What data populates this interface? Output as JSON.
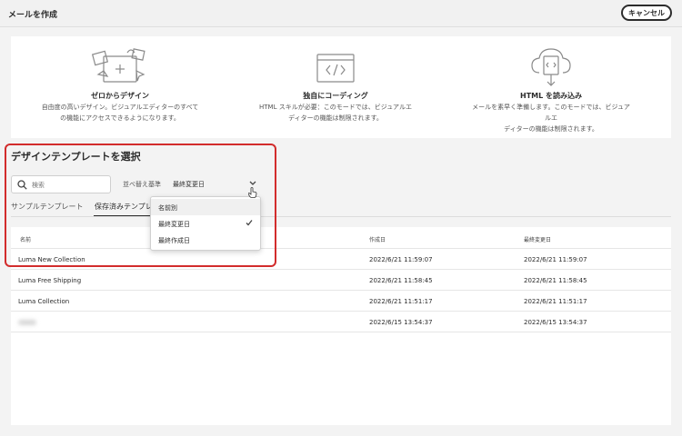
{
  "header": {
    "title": "メールを作成",
    "cancel_label": "キャンセル"
  },
  "options": [
    {
      "title": "ゼロからデザイン",
      "desc_line1": "自由度の高いデザイン。ビジュアルエディターのすべて",
      "desc_line2": "の機能にアクセスできるようになります。",
      "icon": "design-canvas-icon"
    },
    {
      "title": "独自にコーディング",
      "desc_line1": "HTML スキルが必要：このモードでは、ビジュアルエ",
      "desc_line2": "ディターの機能は制限されます。",
      "icon": "code-window-icon"
    },
    {
      "title": "HTML を読み込み",
      "desc_line1": "メールを素早く準備します。このモードでは、ビジュアルエ",
      "desc_line2": "ディターの機能は制限されます。",
      "icon": "cloud-upload-icon"
    }
  ],
  "template_section": {
    "title": "デザインテンプレートを選択",
    "search_placeholder": "検索",
    "sort_label": "並べ替え基準",
    "sort_value": "最終変更日",
    "tabs": [
      {
        "label": "サンプルテンプレート",
        "active": false
      },
      {
        "label": "保存済みテンプレ",
        "active": true
      }
    ],
    "dropdown_options": [
      {
        "label": "名前別",
        "selected": false,
        "hover": true
      },
      {
        "label": "最終変更日",
        "selected": true,
        "hover": false
      },
      {
        "label": "最終作成日",
        "selected": false,
        "hover": false
      }
    ]
  },
  "table": {
    "columns": [
      "名前",
      "作成日",
      "最終変更日"
    ],
    "rows": [
      [
        "Luma New Collection",
        "2022/6/21 11:59:07",
        "2022/6/21 11:59:07"
      ],
      [
        "Luma Free Shipping",
        "2022/6/21 11:58:45",
        "2022/6/21 11:58:45"
      ],
      [
        "Luma Collection",
        "2022/6/21 11:51:17",
        "2022/6/21 11:51:17"
      ],
      [
        "",
        "2022/6/15 13:54:37",
        "2022/6/15 13:54:37"
      ]
    ]
  },
  "colors": {
    "highlight": "#d22c2c",
    "text": "#2c2c2c",
    "background": "#f3f3f3"
  }
}
